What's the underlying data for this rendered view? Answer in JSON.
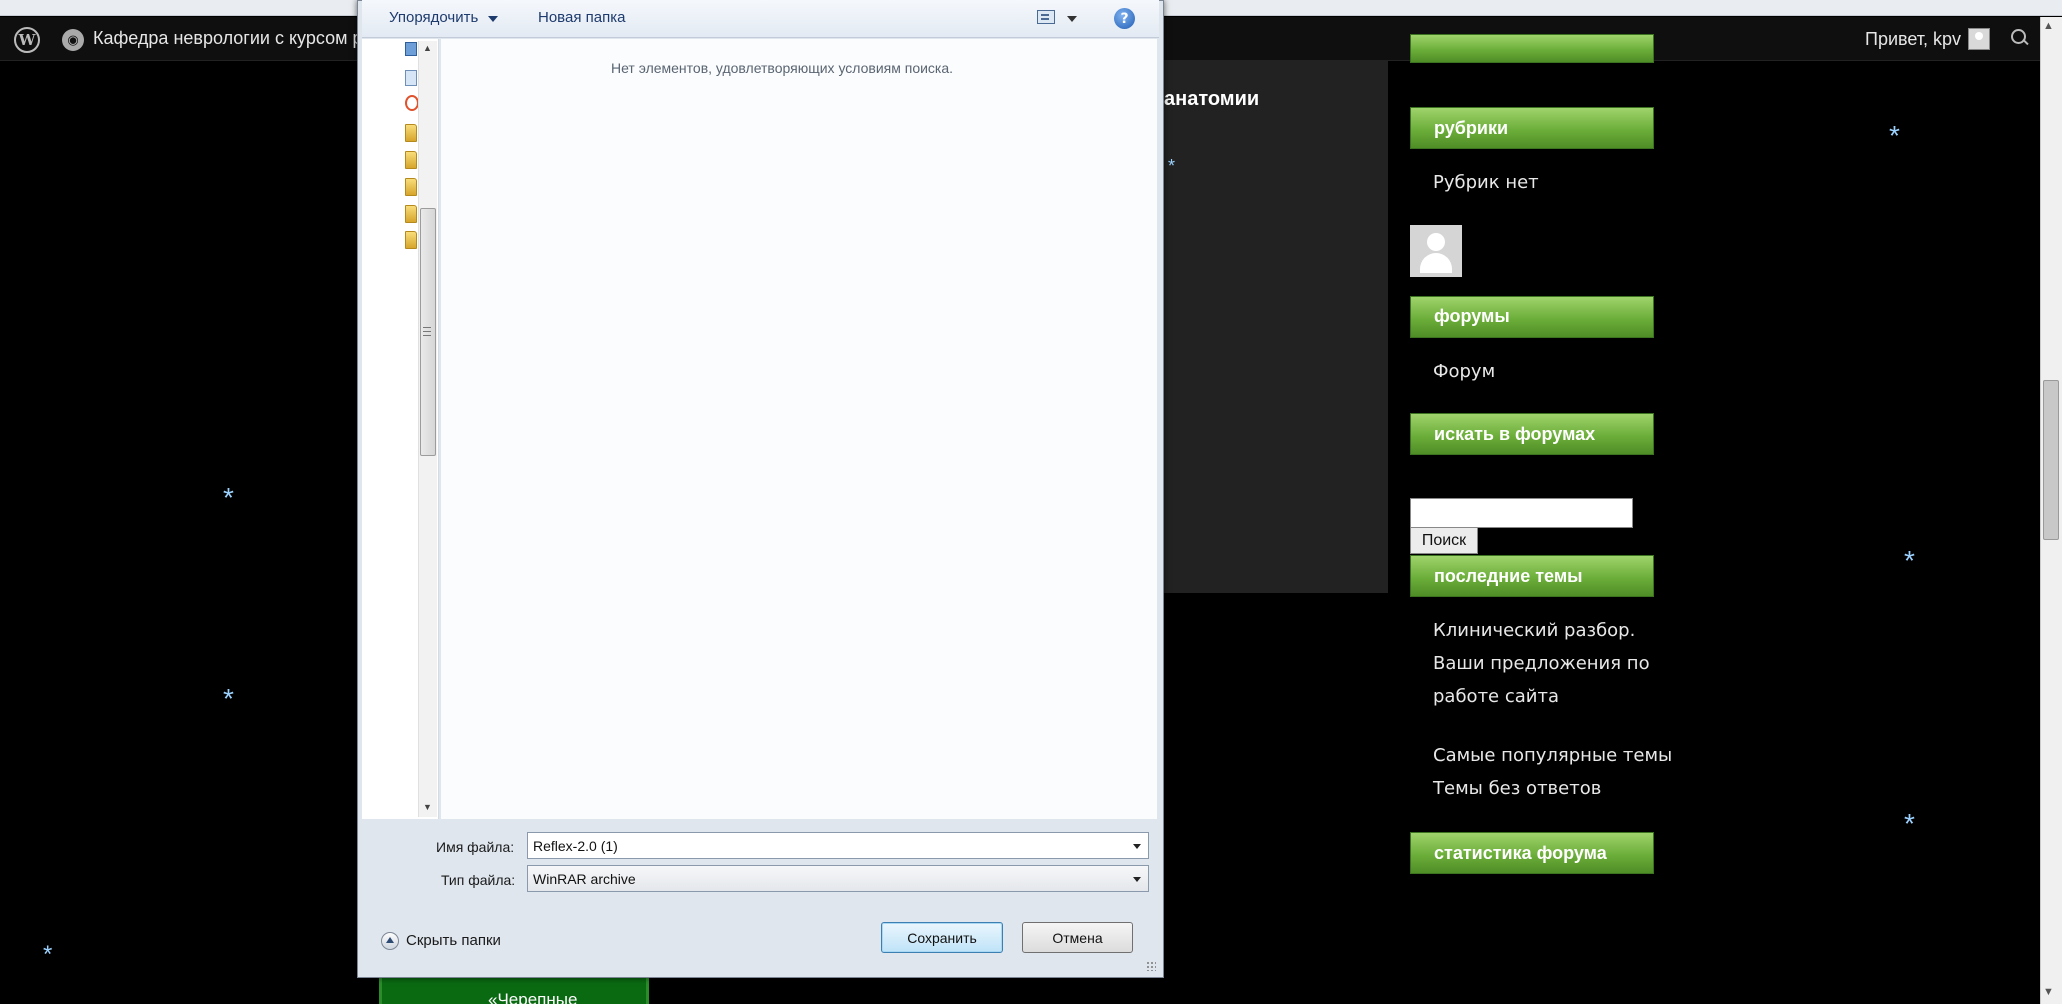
{
  "adminbar": {
    "site_name": "Кафедра неврологии с курсом ре",
    "greeting": "Привет, kpv"
  },
  "content": {
    "heading_fragment": "анатомии",
    "bottom_tag": "«Черепные"
  },
  "sidebar": {
    "rubrics_title": "рубрики",
    "rubrics_empty": "Рубрик нет",
    "forums_title": "форумы",
    "forum_link": "Форум",
    "search_forums_title": "искать в форумах",
    "search_button": "Поиск",
    "recent_topics_title": "последние темы",
    "recent_topics": [
      "Клинический разбор.",
      "Ваши предложения по",
      "работе сайта"
    ],
    "popular_topics": "Самые популярные темы",
    "unanswered_topics": "Темы без ответов",
    "forum_stats_title": "статистика форума"
  },
  "dialog": {
    "organize": "Упорядочить",
    "new_folder": "Новая папка",
    "help": "?",
    "empty_message": "Нет элементов, удовлетворяющих условиям поиска.",
    "filename_label": "Имя файла:",
    "filename_value": "Reflex-2.0 (1)",
    "filetype_label": "Тип файла:",
    "filetype_value": "WinRAR archive",
    "hide_folders": "Скрыть папки",
    "save_button": "Сохранить",
    "cancel_button": "Отмена"
  },
  "decor": {
    "snowflake": "*"
  },
  "colors": {
    "widget_green": "#6cae3a",
    "page_bg": "#000000",
    "snow": "#9cd2ff"
  }
}
